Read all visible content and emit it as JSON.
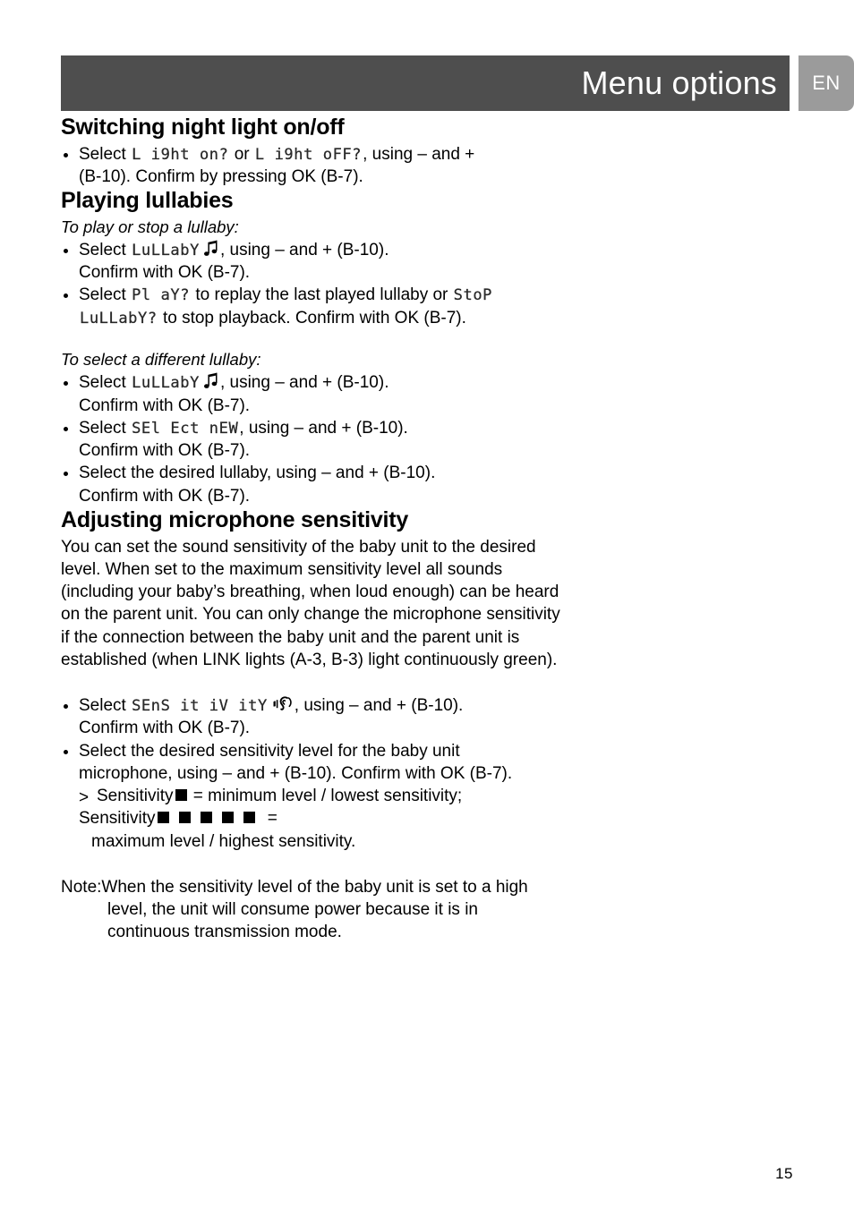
{
  "header": {
    "title": "Menu options",
    "language_tab": "EN",
    "bar_color": "#4e4e4e",
    "tab_color": "#9b9b9b"
  },
  "sections": [
    {
      "id": "night-light",
      "title": "Switching night light on/off",
      "bullets": [
        {
          "line1_pre": "Select ",
          "lcd1": "L i9ht on?",
          "mid": " or ",
          "lcd2": "L i9ht oFF?",
          "post": ", using – and +",
          "line2": "(B-10). Confirm by pressing OK (B-7)."
        }
      ]
    },
    {
      "id": "lullabies",
      "title": "Playing lullabies",
      "subtitle_1": "To play or stop a lullaby:",
      "bullets_1": [
        {
          "pre": "Select ",
          "lcd": "LuLLabY",
          "icon": "music-note-icon",
          "post": ", using – and + (B-10).",
          "line2": "Confirm with OK (B-7)."
        },
        {
          "pre": "Select ",
          "lcd": "Pl aY?",
          "mid": " to replay the last played lullaby or ",
          "lcd2": "StoP",
          "lcd3": "LuLLabY?",
          "post": " to stop playback. Confirm with OK (B-7)."
        }
      ],
      "subtitle_2": "To select a different lullaby:",
      "bullets_2": [
        {
          "pre": "Select ",
          "lcd": "LuLLabY",
          "icon": "music-note-icon",
          "post": ", using – and + (B-10).",
          "line2": "Confirm with OK (B-7)."
        },
        {
          "pre": "Select ",
          "lcd": "SEl Ect nEW",
          "post": ", using – and + (B-10).",
          "line2": "Confirm with OK (B-7)."
        },
        {
          "pre": "Select the desired lullaby, using – and + (B-10).",
          "line2": "Confirm with OK (B-7)."
        }
      ]
    },
    {
      "id": "mic-sensitivity",
      "title": "Adjusting microphone sensitivity",
      "paragraph": "You can set the sound sensitivity of the baby unit to the desired level. When set to the maximum sensitivity level all sounds (including your baby’s breathing, when loud enough) can be heard on the parent unit. You can only change the microphone sensitivity if the connection between the baby unit and the parent unit is established (when LINK lights (A-3, B-3) light continuously green).",
      "bullets": [
        {
          "pre": "Select ",
          "lcd": "SEnS it iV itY",
          "icon": "ear-sound-icon",
          "post": ", using – and + (B-10).",
          "line2": "Confirm with OK (B-7)."
        },
        {
          "pre": "Select the desired sensitivity level for the baby unit",
          "line2": "microphone, using – and + (B-10). Confirm with OK (B-7)."
        }
      ],
      "levels": {
        "arrow": ">",
        "min_label": "Sensitivity",
        "min_squares": 1,
        "min_text": " = minimum level / lowest sensitivity;",
        "max_label": "Sensitivity",
        "max_squares": 5,
        "max_text": " =",
        "max_text_2": "maximum level / highest sensitivity."
      },
      "note": {
        "label": "Note:",
        "line1": "When the sensitivity level of the baby unit is set to a high",
        "line2": "level, the unit will consume power because it is in",
        "line3": "continuous transmission mode."
      }
    }
  ],
  "footer": {
    "page_number": "15"
  }
}
